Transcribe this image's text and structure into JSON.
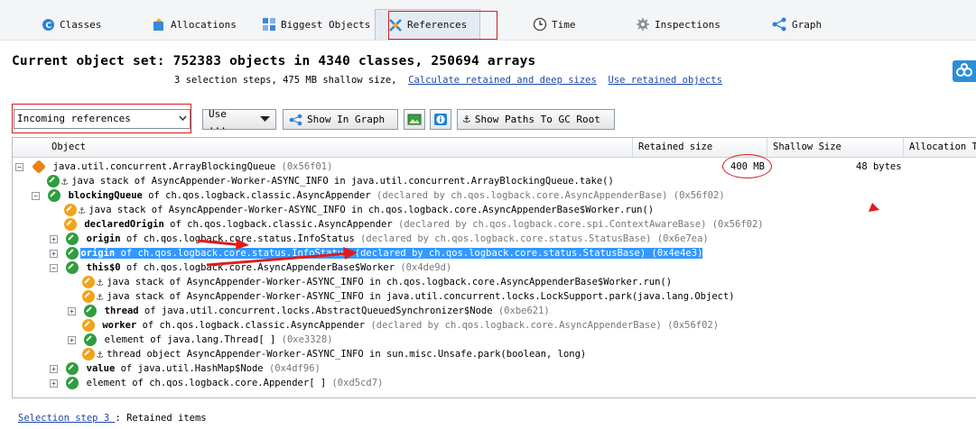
{
  "tabs": [
    {
      "label": "Classes",
      "icon": "classes-icon"
    },
    {
      "label": "Allocations",
      "icon": "allocations-icon"
    },
    {
      "label": "Biggest Objects",
      "icon": "biggest-objects-icon"
    },
    {
      "label": "References",
      "icon": "references-icon"
    },
    {
      "label": "Time",
      "icon": "time-icon"
    },
    {
      "label": "Inspections",
      "icon": "inspections-icon"
    },
    {
      "label": "Graph",
      "icon": "graph-icon"
    }
  ],
  "active_tab": "References",
  "summary": {
    "title": "Current object set: 752383 objects in 4340 classes, 250694 arrays",
    "sub": "3 selection steps, 475 MB shallow size,",
    "link_calculate": "Calculate retained and deep sizes",
    "link_use_retained": "Use retained objects"
  },
  "toolbar": {
    "combo_value": "Incoming references",
    "use_button": "Use ...",
    "show_graph": "Show In Graph",
    "show_paths": "Show Paths To GC Root"
  },
  "columns": [
    "Object",
    "Retained size",
    "Shallow Size",
    "Allocation Ti"
  ],
  "rows": [
    {
      "pre": "",
      "bold": "",
      "text": "java.util.concurrent.ArrayBlockingQueue ",
      "gray": "(0x56f01)",
      "retained": "400 MB",
      "shallow": "48 bytes"
    },
    {
      "pre": "",
      "bold": "",
      "text": "java stack of AsyncAppender-Worker-ASYNC_INFO in java.util.concurrent.ArrayBlockingQueue.take()",
      "gray": ""
    },
    {
      "pre": "",
      "bold": "blockingQueue",
      "text": " of ch.qos.logback.classic.AsyncAppender ",
      "gray": "(declared by ch.qos.logback.core.AsyncAppenderBase) (0x56f02)"
    },
    {
      "pre": "",
      "bold": "",
      "text": "java stack of AsyncAppender-Worker-ASYNC_INFO in ch.qos.logback.core.AsyncAppenderBase$Worker.run()",
      "gray": ""
    },
    {
      "pre": "",
      "bold": "declaredOrigin",
      "text": " of ch.qos.logback.classic.AsyncAppender ",
      "gray": "(declared by ch.qos.logback.core.spi.ContextAwareBase) (0x56f02)"
    },
    {
      "pre": "",
      "bold": "origin",
      "text": " of ch.qos.logback.core.status.InfoStatus ",
      "gray": "(declared by ch.qos.logback.core.status.StatusBase) (0x6e7ea)"
    },
    {
      "pre": "",
      "bold": "origin",
      "text": " of ch.qos.logback.core.status.InfoStatus ",
      "gray": "(declared by ch.qos.logback.core.status.StatusBase) (0x4e4e3)"
    },
    {
      "pre": "",
      "bold": "this$0",
      "text": " of ch.qos.logback.core.AsyncAppenderBase$Worker ",
      "gray": "(0x4de9d)"
    },
    {
      "pre": "",
      "bold": "",
      "text": "java stack of AsyncAppender-Worker-ASYNC_INFO in ch.qos.logback.core.AsyncAppenderBase$Worker.run()",
      "gray": ""
    },
    {
      "pre": "",
      "bold": "",
      "text": "java stack of AsyncAppender-Worker-ASYNC_INFO in java.util.concurrent.locks.LockSupport.park(java.lang.Object)",
      "gray": ""
    },
    {
      "pre": "",
      "bold": "thread",
      "text": " of java.util.concurrent.locks.AbstractQueuedSynchronizer$Node ",
      "gray": "(0xbe621)"
    },
    {
      "pre": "",
      "bold": "worker",
      "text": " of ch.qos.logback.classic.AsyncAppender ",
      "gray": "(declared by ch.qos.logback.core.AsyncAppenderBase) (0x56f02)"
    },
    {
      "pre": "",
      "bold": "",
      "text": "element of java.lang.Thread[ ] ",
      "gray": "(0xe3328)"
    },
    {
      "pre": "",
      "bold": "",
      "text": "thread object AsyncAppender-Worker-ASYNC_INFO in sun.misc.Unsafe.park(boolean, long)",
      "gray": ""
    },
    {
      "pre": "",
      "bold": "value",
      "text": " of java.util.HashMap$Node ",
      "gray": "(0x4df96)"
    },
    {
      "pre": "",
      "bold": "",
      "text": "element of ch.qos.logback.core.Appender[ ] ",
      "gray": "(0xd5cd7)"
    }
  ],
  "footer": {
    "link": "Selection step 3 ",
    "text": ": Retained items"
  }
}
